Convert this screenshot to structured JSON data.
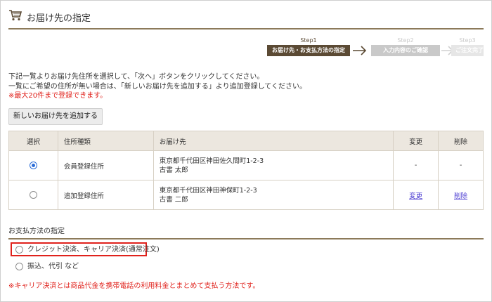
{
  "header": {
    "title": "お届け先の指定",
    "icon": "shopping-cart-icon"
  },
  "steps": [
    {
      "num": "Step1",
      "label": "お届け先・お支払方法の指定",
      "state": "active"
    },
    {
      "num": "Step2",
      "label": "入力内容のご確認",
      "state": "inactive"
    },
    {
      "num": "Step3",
      "label": "ご注文完了",
      "state": "inactive"
    }
  ],
  "instructions": {
    "line1": "下記一覧よりお届け先住所を選択して、「次へ」ボタンをクリックしてください。",
    "line2": "一覧にご希望の住所が無い場合は、「新しいお届け先を追加する」より追加登録してください。",
    "note": "※最大20件まで登録できます。"
  },
  "add_button": {
    "label": "新しいお届け先を追加する"
  },
  "table": {
    "headers": {
      "select": "選択",
      "type": "住所種類",
      "address": "お届け先",
      "edit": "変更",
      "delete": "削除"
    },
    "rows": [
      {
        "selected": true,
        "type": "会員登録住所",
        "address": "東京都千代田区神田佐久間町1-2-3",
        "name": "古書 太郎",
        "edit": "-",
        "delete": "-"
      },
      {
        "selected": false,
        "type": "追加登録住所",
        "address": "東京都千代田区神田神保町1-2-3",
        "name": "古書 二郎",
        "edit": "変更",
        "delete": "削除"
      }
    ]
  },
  "payment": {
    "title": "お支払方法の指定",
    "options": [
      {
        "label": "クレジット決済、キャリア決済(通常注文)",
        "selected": false,
        "highlighted": true
      },
      {
        "label": "振込、代引 など",
        "selected": false
      }
    ],
    "note": "※キャリア決済とは商品代金を携帯電話の利用料金とまとめて支払う方法です。"
  },
  "colors": {
    "accent_brown": "#5b4a34",
    "rule": "#8c7a5a",
    "warning_red": "#e0221c",
    "link": "#4a3bd1",
    "table_header": "#ece7df"
  }
}
